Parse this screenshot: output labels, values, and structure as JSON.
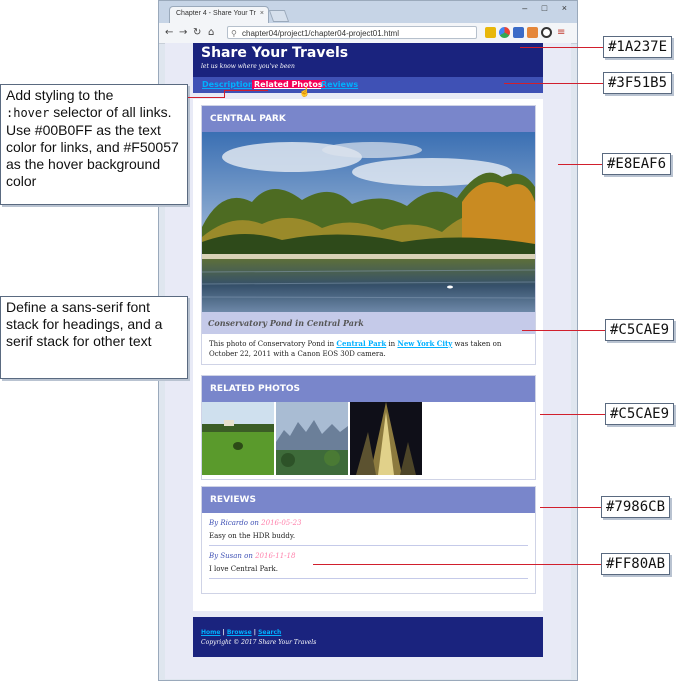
{
  "browser": {
    "tab_title": "Chapter 4 - Share Your Tr",
    "tab_close": "×",
    "url": "chapter04/project1/chapter04-project01.html",
    "window_controls": "– □ ×"
  },
  "site": {
    "title": "Share Your Travels",
    "tagline": "let us know where you've been",
    "nav": [
      "Description",
      "Related Photos",
      "Reviews"
    ],
    "hovered_nav_index": 1
  },
  "photo_card": {
    "heading": "CENTRAL PARK",
    "caption": "Conservatory Pond in Central Park",
    "desc_before": "This photo of Conservatory Pond in ",
    "link1": "Central Park",
    "desc_mid": " in ",
    "link2": "New York City",
    "desc_after": " was taken on October 22, 2011 with a Canon EOS 30D camera."
  },
  "related": {
    "heading": "RELATED PHOTOS"
  },
  "reviews": {
    "heading": "REVIEWS",
    "items": [
      {
        "by": "By Ricardo on ",
        "date": "2016-05-23",
        "text": "Easy on the HDR buddy."
      },
      {
        "by": "By Susan on ",
        "date": "2016-11-18",
        "text": "I love Central Park."
      }
    ]
  },
  "footer": {
    "links": [
      "Home",
      "Browse",
      "Search"
    ],
    "separator": " | ",
    "copyright": "Copyright © 2017 Share Your Travels"
  },
  "annotations": {
    "hover_note_1": "Add styling to the",
    "hover_note_code": ":hover",
    "hover_note_2": " selector of all links. Use #00B0FF as the text color for links, and #F50057 as the hover background color",
    "font_note": "Define a sans-serif font stack for headings, and a serif stack for other text",
    "hex_labels": [
      "#1A237E",
      "#3F51B5",
      "#E8EAF6",
      "#C5CAE9",
      "#C5CAE9",
      "#7986CB",
      "#FF80AB"
    ]
  },
  "colors": {
    "header": "#1A237E",
    "nav": "#3F51B5",
    "page_bg": "#E8EAF6",
    "caption_bg": "#C5CAE9",
    "card_heading": "#7986CB",
    "date": "#FF80AB",
    "link": "#00B0FF",
    "hover": "#F50057"
  }
}
